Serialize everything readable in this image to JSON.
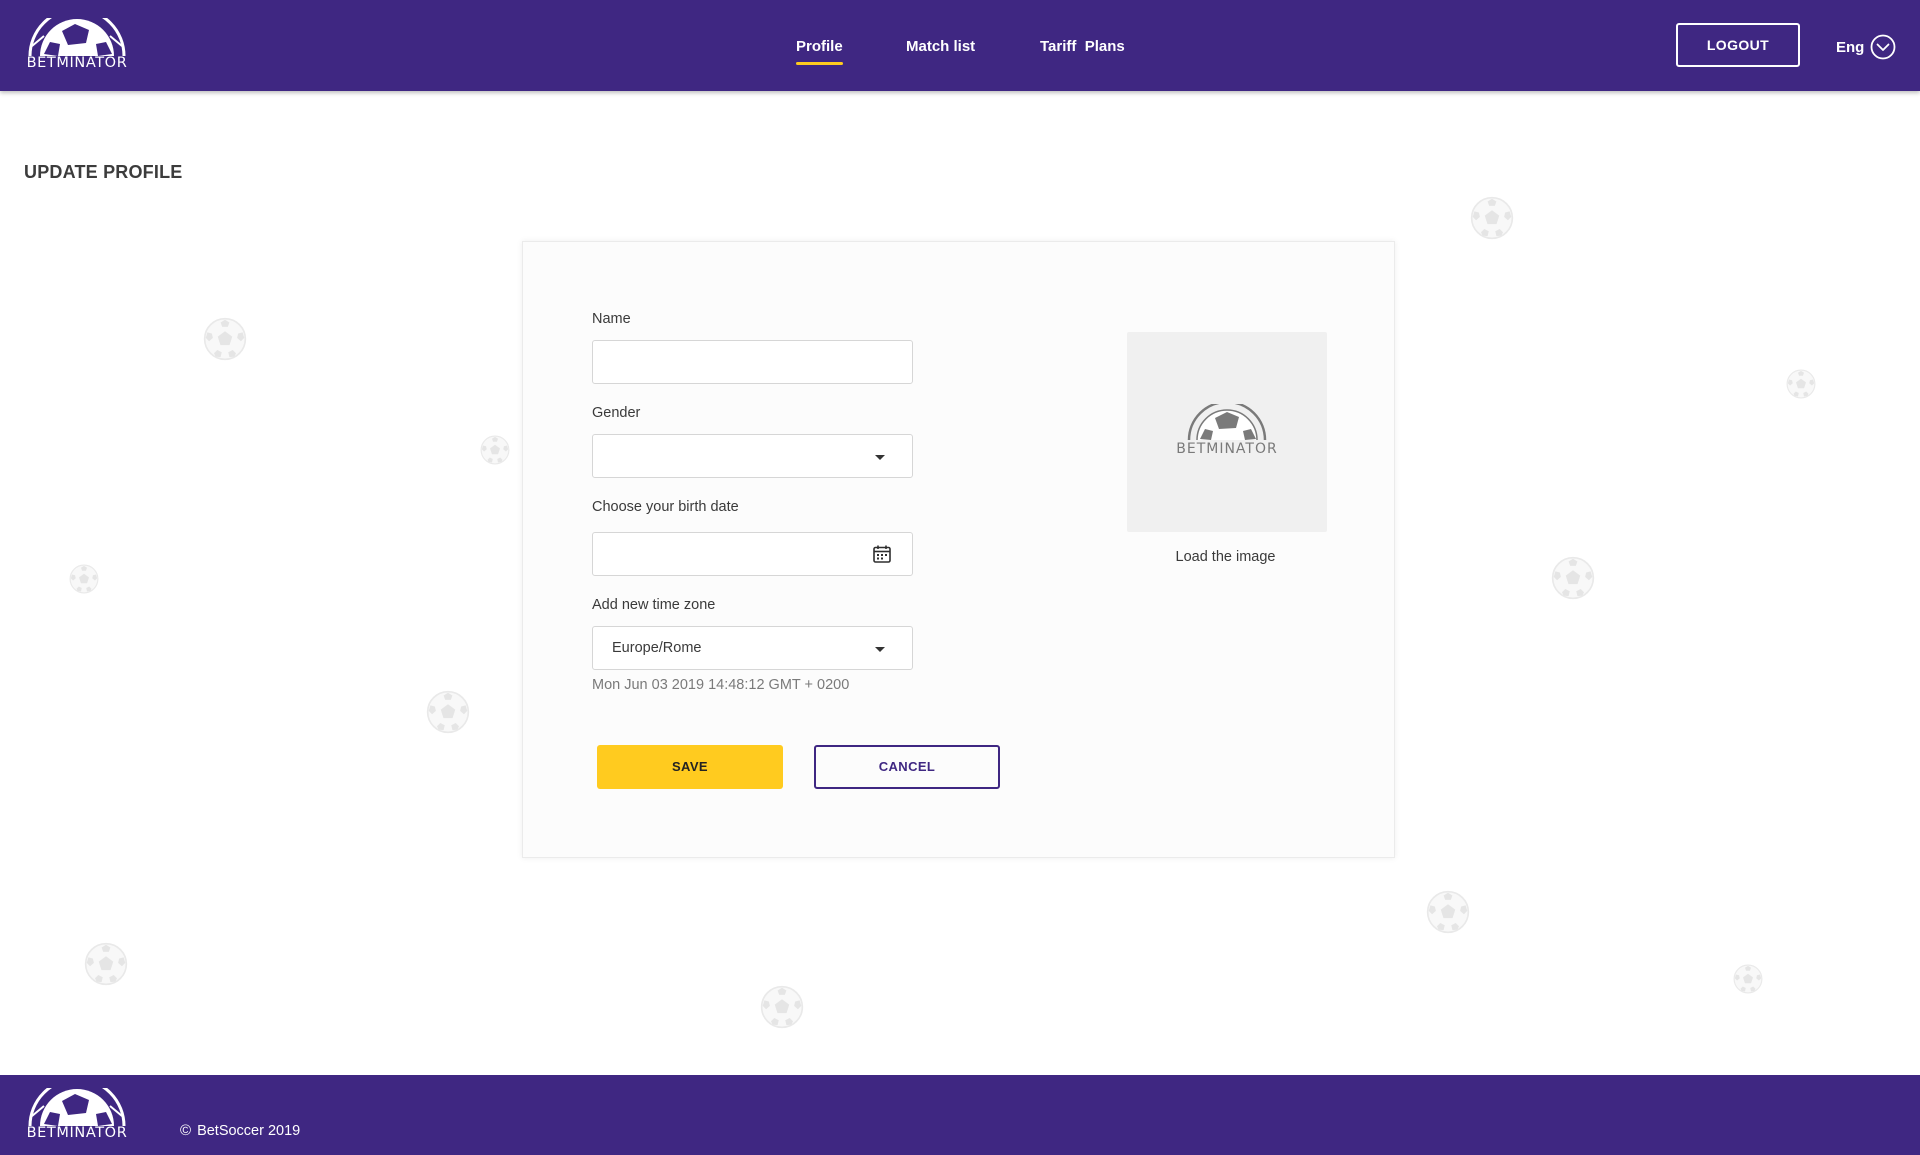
{
  "header": {
    "logo_text": "BETMINATOR",
    "nav": [
      {
        "label": "Profile",
        "active": true
      },
      {
        "label": "Match list",
        "active": false
      },
      {
        "label": "Tariff  Plans",
        "active": false
      }
    ],
    "logout_label": "LOGOUT",
    "language": "Eng",
    "language_icon": "chevron-down-circle-icon"
  },
  "page": {
    "title": "UPDATE PROFILE"
  },
  "form": {
    "name": {
      "label": "Name",
      "value": ""
    },
    "gender": {
      "label": "Gender",
      "value": ""
    },
    "birth_date": {
      "label": "Choose your birth date",
      "value": "",
      "icon": "calendar-icon"
    },
    "timezone": {
      "label": "Add new time zone",
      "value": "Europe/Rome",
      "current_datetime": "Mon Jun 03 2019 14:48:12 GMT + 0200"
    },
    "save_label": "SAVE",
    "cancel_label": "CANCEL"
  },
  "avatar": {
    "placeholder_logo_text": "BETMINATOR",
    "load_label": "Load the image"
  },
  "footer": {
    "logo_text": "BETMINATOR",
    "copyright_symbol": "©",
    "copyright_text": "BetSoccer 2019"
  },
  "colors": {
    "brand_purple": "#3f2782",
    "accent_yellow": "#ffcb1f",
    "background": "#ffffff",
    "card_background": "#fcfcfc",
    "image_placeholder": "#f0f0f0"
  }
}
